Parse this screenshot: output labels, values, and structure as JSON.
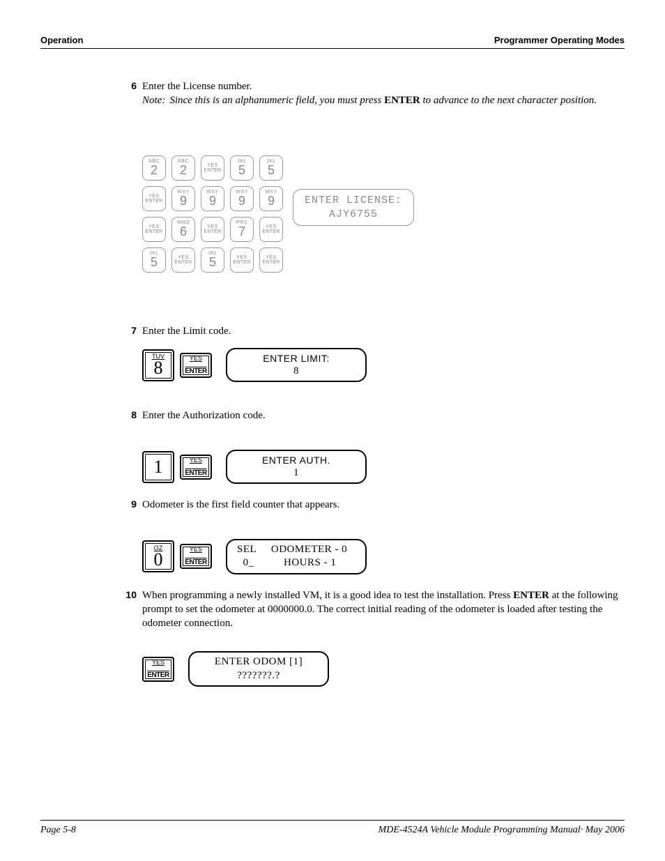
{
  "header": {
    "left": "Operation",
    "right": "Programmer Operating Modes"
  },
  "steps": {
    "s6": {
      "num": "6",
      "text": "Enter the License number.",
      "note_label": "Note:",
      "note_text": "Since this is an alphanumeric field, you must press ",
      "note_bold": "ENTER",
      "note_text2": " to advance to the next character position."
    },
    "s7": {
      "num": "7",
      "text": "Enter the Limit code."
    },
    "s8": {
      "num": "8",
      "text": "Enter the Authorization code."
    },
    "s9": {
      "num": "9",
      "text": "Odometer is the first field counter that appears."
    },
    "s10": {
      "num": "10",
      "text_a": "When programming a newly installed VM, it is a good idea to test the installation. Press ",
      "text_bold": "ENTER",
      "text_b": " at the following prompt to set the odometer at 0000000.0. The correct initial reading of the odometer is loaded after testing the odometer connection."
    }
  },
  "fig6": {
    "rows": [
      [
        {
          "top": "ABC",
          "mid": "2"
        },
        {
          "top": "ABC",
          "mid": "2"
        },
        {
          "top": "YES",
          "bot": "ENTER"
        },
        {
          "top": "JKL",
          "mid": "5"
        },
        {
          "top": "JKL",
          "mid": "5"
        }
      ],
      [
        {
          "top": "YES",
          "bot": "ENTER"
        },
        {
          "top": "WXY",
          "mid": "9"
        },
        {
          "top": "WXY",
          "mid": "9"
        },
        {
          "top": "WXY",
          "mid": "9"
        },
        {
          "top": "WXY",
          "mid": "9"
        }
      ],
      [
        {
          "top": "YES",
          "bot": "ENTER"
        },
        {
          "top": "MNO",
          "mid": "6"
        },
        {
          "top": "YES",
          "bot": "ENTER"
        },
        {
          "top": "PRS",
          "mid": "7"
        },
        {
          "top": "YES",
          "bot": "ENTER"
        }
      ],
      [
        {
          "top": "JKL",
          "mid": "5"
        },
        {
          "top": "YES",
          "bot": "ENTER"
        },
        {
          "top": "JKL",
          "mid": "5"
        },
        {
          "top": "YES",
          "bot": "ENTER"
        },
        {
          "top": "YES",
          "bot": "ENTER"
        }
      ]
    ],
    "display": {
      "line1": "ENTER LICENSE:",
      "line2": "AJY6755"
    }
  },
  "fig7": {
    "key": {
      "top": "TUV",
      "mid": "8"
    },
    "enter": {
      "top": "YES",
      "bot": "ENTER"
    },
    "display": {
      "line1": "ENTER LIMIT:",
      "line2": "8"
    }
  },
  "fig8": {
    "key": {
      "top": "",
      "mid": "1"
    },
    "enter": {
      "top": "YES",
      "bot": "ENTER"
    },
    "display": {
      "line1": "ENTER AUTH.",
      "line2": "1"
    }
  },
  "fig9": {
    "key": {
      "top": "OZ",
      "mid": "0"
    },
    "enter": {
      "top": "YES",
      "bot": "ENTER"
    },
    "display": {
      "line1": "SEL     ODOMETER - 0",
      "line2": "  0_          HOURS - 1"
    }
  },
  "fig10": {
    "enter": {
      "top": "YES",
      "bot": "ENTER"
    },
    "display": {
      "line1": "ENTER ODOM [1]",
      "line2": "???????.?"
    }
  },
  "footer": {
    "left": "Page 5-8",
    "right": "MDE-4524A Vehicle Module Programming Manual· May 2006"
  }
}
